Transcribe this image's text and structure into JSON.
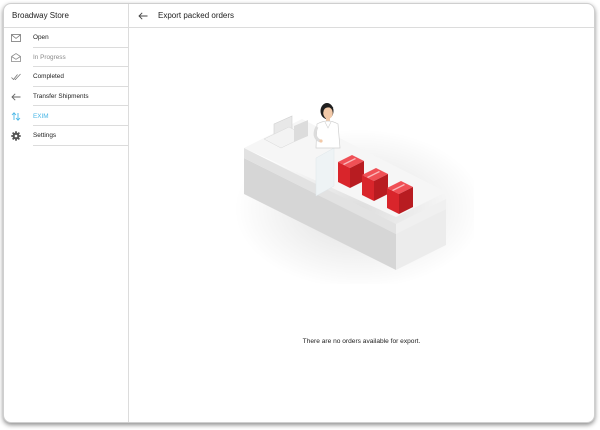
{
  "sidebar": {
    "store_name": "Broadway Store",
    "items": [
      {
        "label": "Open",
        "icon": "mail-icon",
        "state": "normal"
      },
      {
        "label": "In Progress",
        "icon": "mail-open-icon",
        "state": "muted"
      },
      {
        "label": "Completed",
        "icon": "done-all-icon",
        "state": "normal"
      },
      {
        "label": "Transfer Shipments",
        "icon": "arrow-left-icon",
        "state": "normal"
      },
      {
        "label": "EXIM",
        "icon": "swap-vertical-icon",
        "state": "active"
      },
      {
        "label": "Settings",
        "icon": "gear-icon",
        "state": "normal"
      }
    ]
  },
  "main": {
    "title": "Export packed orders",
    "empty_message": "There are no orders available for export."
  },
  "colors": {
    "accent": "#49b6e6",
    "muted_text": "#8a8a8a",
    "box_red": "#e0262b"
  }
}
